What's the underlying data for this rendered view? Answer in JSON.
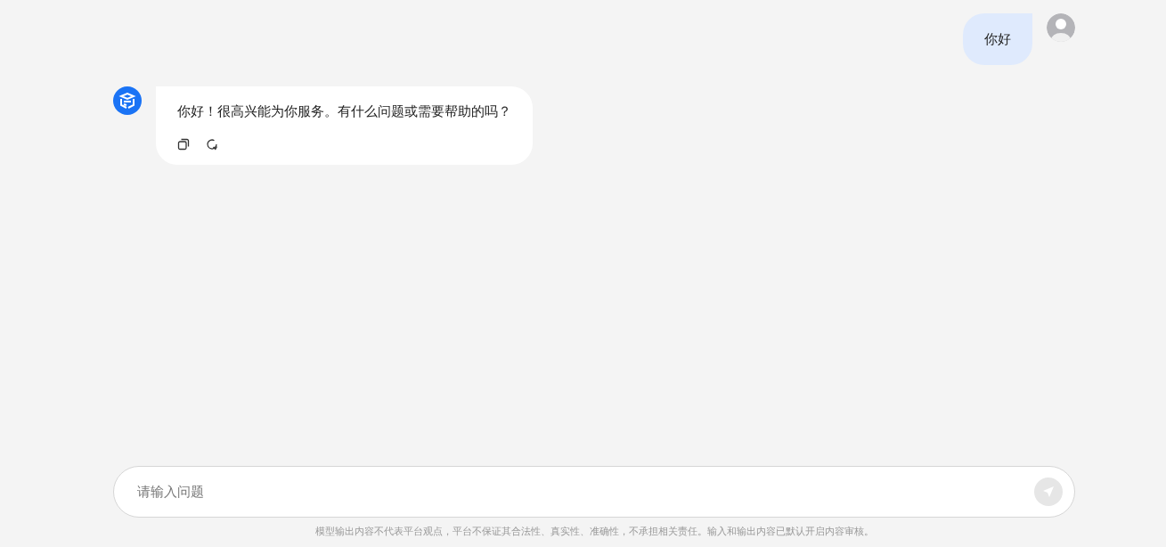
{
  "messages": [
    {
      "kind": "user",
      "text": "你好"
    },
    {
      "kind": "assistant",
      "text": "你好！很高兴能为你服务。有什么问题或需要帮助的吗？",
      "actions": [
        {
          "kind": "copy"
        },
        {
          "kind": "regenerate"
        }
      ]
    }
  ],
  "composer": {
    "placeholder": "请输入问题",
    "send_disabled": true
  },
  "disclaimer": "模型输出内容不代表平台观点，平台不保证其合法性、真实性、准确性，不承担相关责任。输入和输出内容已默认开启内容审核。"
}
